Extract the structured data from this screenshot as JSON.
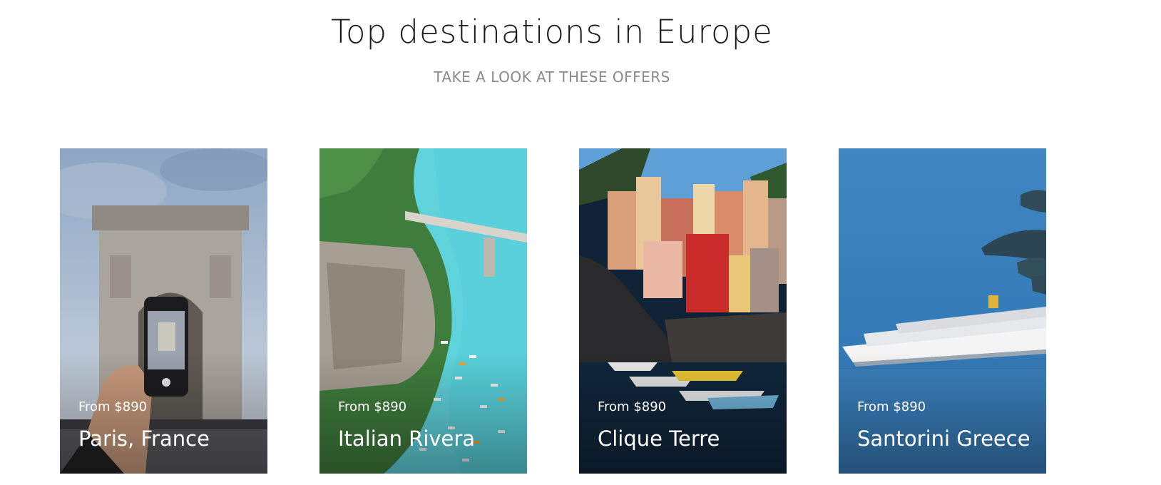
{
  "header": {
    "title": "Top destinations in Europe",
    "subtitle": "TAKE A LOOK AT THESE OFFERS"
  },
  "cards": [
    {
      "price": "From $890",
      "name": "Paris, France"
    },
    {
      "price": "From $890",
      "name": "Italian Rivera"
    },
    {
      "price": "From $890",
      "name": "Clique Terre"
    },
    {
      "price": "From $890",
      "name": "Santorini Greece"
    }
  ],
  "colors": {
    "title": "#1a1a1a",
    "subtitle": "#8a8a8a",
    "card_text": "#ffffff"
  }
}
